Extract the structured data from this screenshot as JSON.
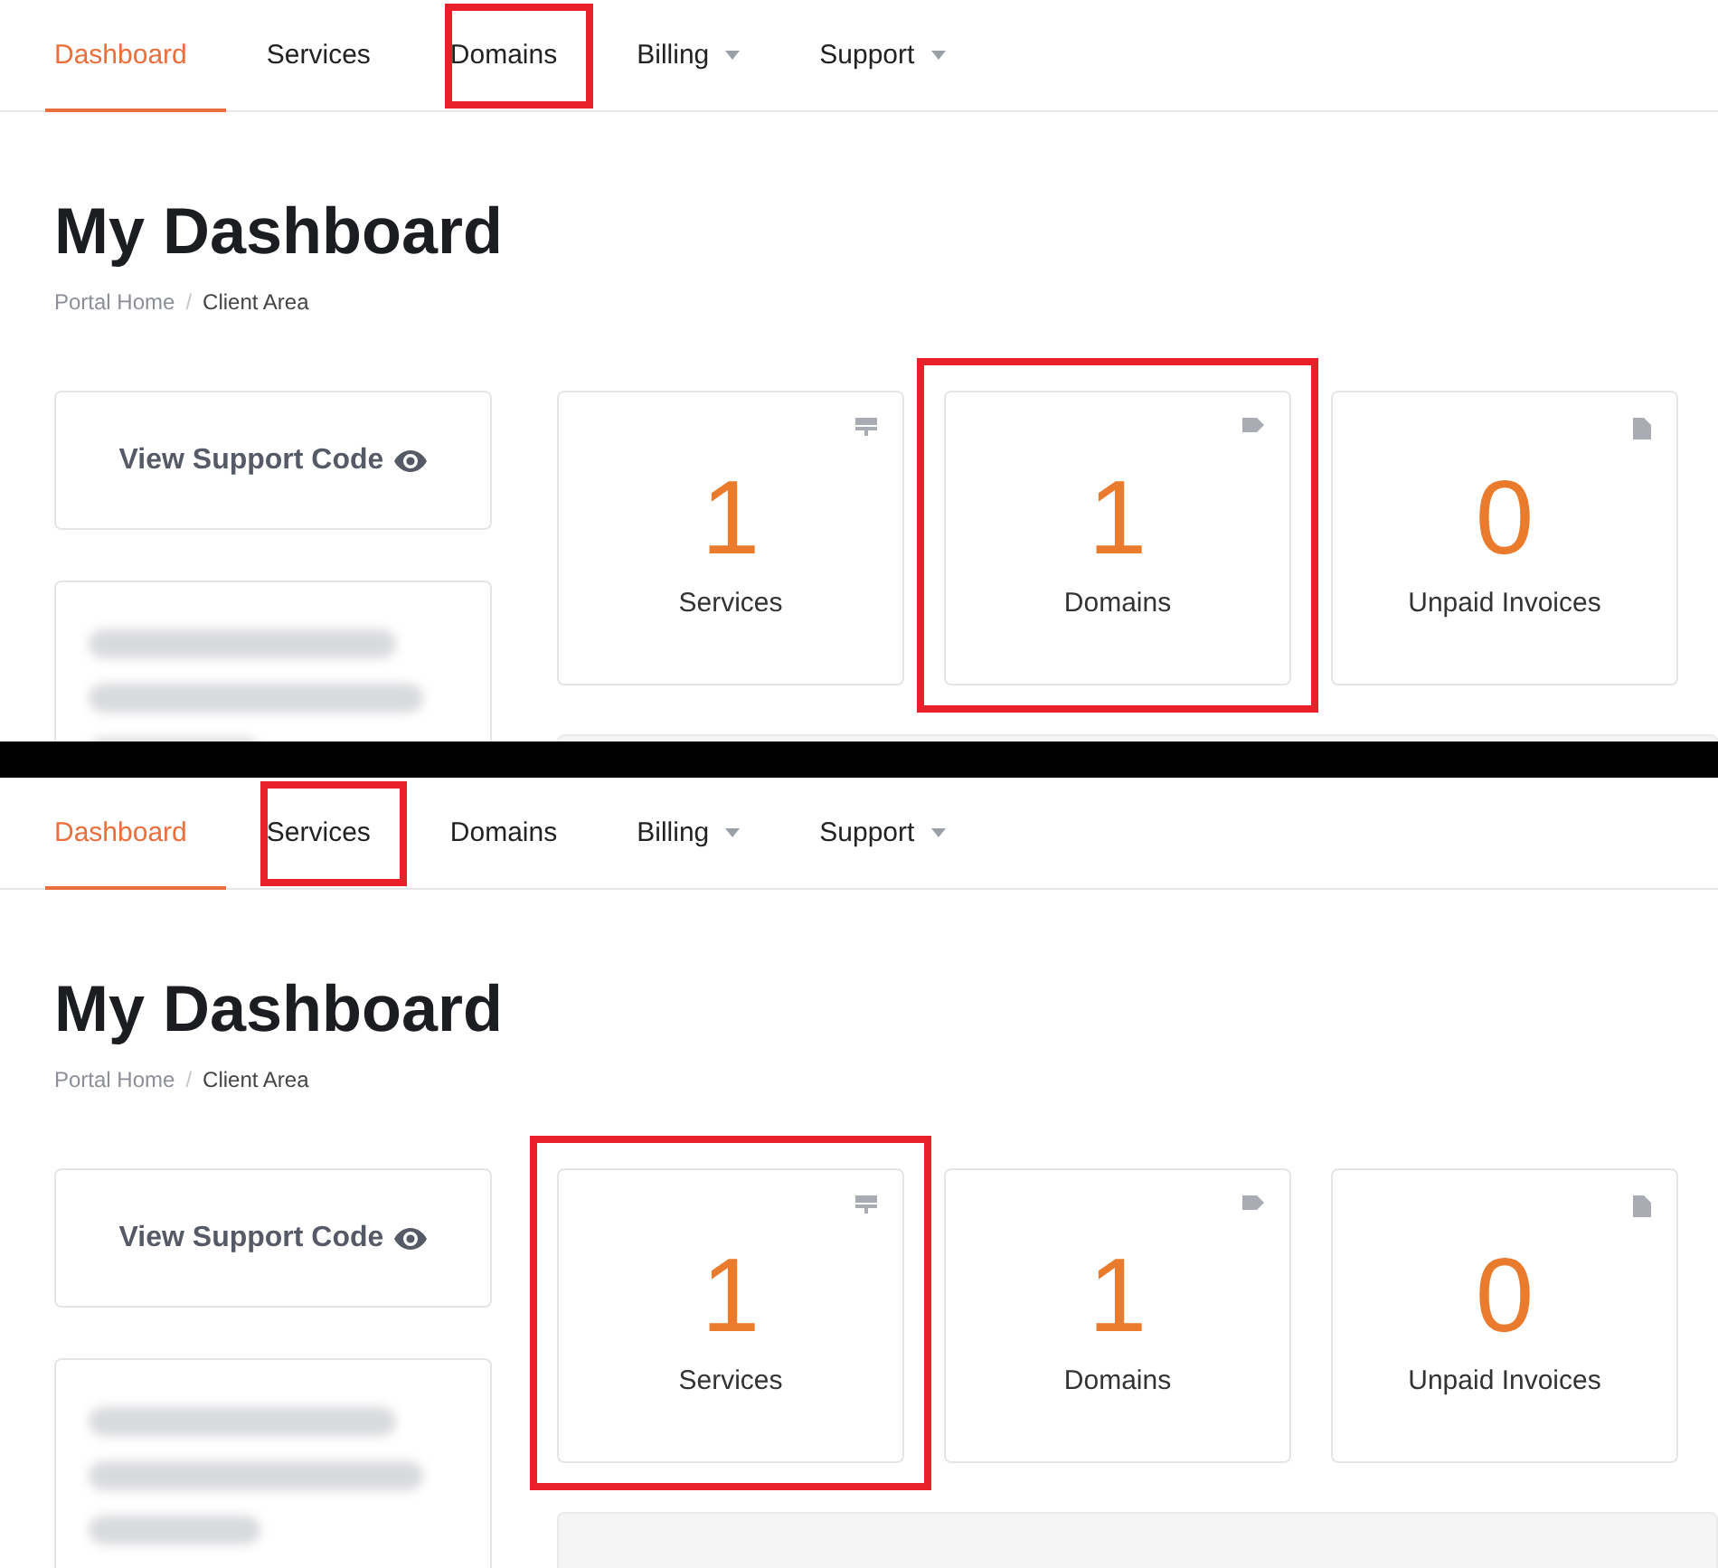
{
  "panels": [
    {
      "nav": [
        {
          "label": "Dashboard",
          "selected": true,
          "dropdown": false,
          "highlighted": false
        },
        {
          "label": "Services",
          "selected": false,
          "dropdown": false,
          "highlighted": false
        },
        {
          "label": "Domains",
          "selected": false,
          "dropdown": false,
          "highlighted": true
        },
        {
          "label": "Billing",
          "selected": false,
          "dropdown": true,
          "highlighted": false
        },
        {
          "label": "Support",
          "selected": false,
          "dropdown": true,
          "highlighted": false
        }
      ],
      "title": "My Dashboard",
      "breadcrumb": [
        "Portal Home",
        "Client Area"
      ],
      "breadcrumb_separator": "/",
      "support_button": "View Support Code",
      "stats": [
        {
          "kind": "services",
          "count": "1",
          "label": "Services",
          "highlighted": false
        },
        {
          "kind": "domains",
          "count": "1",
          "label": "Domains",
          "highlighted": true
        },
        {
          "kind": "invoices",
          "count": "0",
          "label": "Unpaid Invoices",
          "highlighted": false
        }
      ]
    },
    {
      "nav": [
        {
          "label": "Dashboard",
          "selected": true,
          "dropdown": false,
          "highlighted": false
        },
        {
          "label": "Services",
          "selected": false,
          "dropdown": false,
          "highlighted": true
        },
        {
          "label": "Domains",
          "selected": false,
          "dropdown": false,
          "highlighted": false
        },
        {
          "label": "Billing",
          "selected": false,
          "dropdown": true,
          "highlighted": false
        },
        {
          "label": "Support",
          "selected": false,
          "dropdown": true,
          "highlighted": false
        }
      ],
      "title": "My Dashboard",
      "breadcrumb": [
        "Portal Home",
        "Client Area"
      ],
      "breadcrumb_separator": "/",
      "support_button": "View Support Code",
      "stats": [
        {
          "kind": "services",
          "count": "1",
          "label": "Services",
          "highlighted": true
        },
        {
          "kind": "domains",
          "count": "1",
          "label": "Domains",
          "highlighted": false
        },
        {
          "kind": "invoices",
          "count": "0",
          "label": "Unpaid Invoices",
          "highlighted": false
        }
      ]
    }
  ]
}
